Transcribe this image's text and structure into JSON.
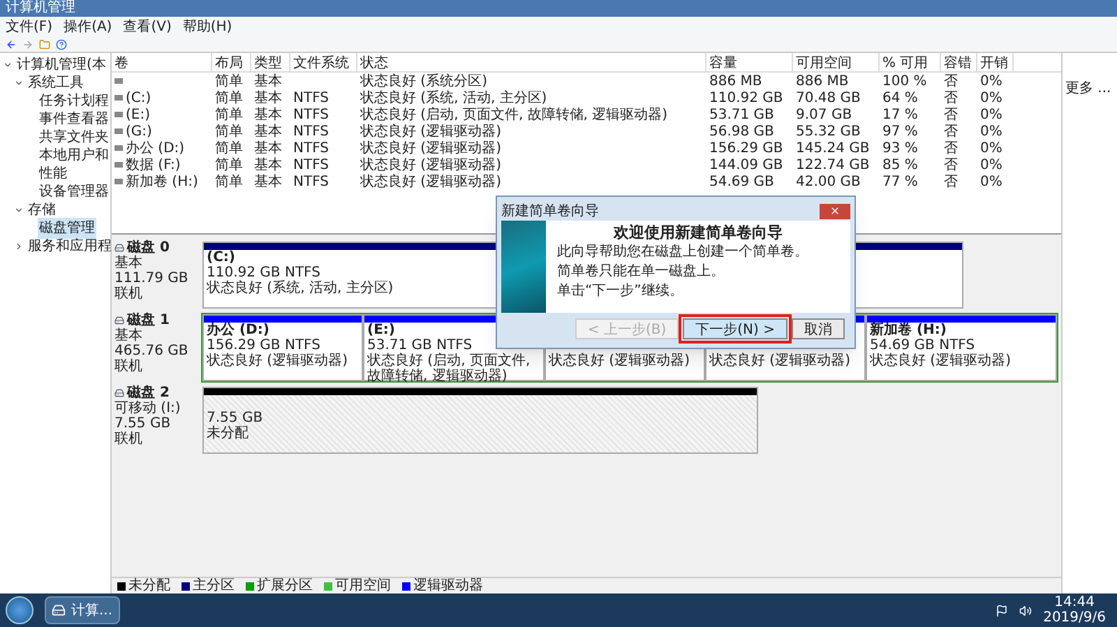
{
  "window": {
    "title": "计算机管理"
  },
  "menu": [
    "文件(F)",
    "操作(A)",
    "查看(V)",
    "帮助(H)"
  ],
  "tree": [
    {
      "label": "计算机管理(本",
      "expanded": true,
      "selected": false,
      "children": [
        {
          "label": "系统工具",
          "expanded": true,
          "selected": false,
          "children": [
            {
              "label": "任务计划程",
              "selected": false
            },
            {
              "label": "事件查看器",
              "selected": false
            },
            {
              "label": "共享文件夹",
              "selected": false
            },
            {
              "label": "本地用户和",
              "selected": false
            },
            {
              "label": "性能",
              "selected": false
            },
            {
              "label": "设备管理器",
              "selected": false
            }
          ]
        },
        {
          "label": "存储",
          "expanded": true,
          "selected": false,
          "children": [
            {
              "label": "磁盘管理",
              "selected": true
            }
          ]
        },
        {
          "label": "服务和应用程",
          "expanded": false,
          "selected": false
        }
      ]
    }
  ],
  "table": {
    "columns": [
      "卷",
      "布局",
      "类型",
      "文件系统",
      "状态",
      "容量",
      "可用空间",
      "% 可用",
      "容错",
      "开销"
    ],
    "rows": [
      {
        "layout": "简单",
        "type": "基本",
        "status": "状态良好 (系统分区)",
        "capacity": "886 MB",
        "free": "886 MB",
        "percent": "100 %",
        "fault": "否",
        "overhead": "0%"
      },
      {
        "volume": "(C:)",
        "layout": "简单",
        "type": "基本",
        "fs": "NTFS",
        "status": "状态良好 (系统, 活动, 主分区)",
        "capacity": "110.92 GB",
        "free": "70.48 GB",
        "percent": "64 %",
        "fault": "否",
        "overhead": "0%"
      },
      {
        "volume": "(E:)",
        "layout": "简单",
        "type": "基本",
        "fs": "NTFS",
        "status": "状态良好 (启动, 页面文件, 故障转储, 逻辑驱动器)",
        "capacity": "53.71 GB",
        "free": "9.07 GB",
        "percent": "17 %",
        "fault": "否",
        "overhead": "0%"
      },
      {
        "volume": "(G:)",
        "layout": "简单",
        "type": "基本",
        "fs": "NTFS",
        "status": "状态良好 (逻辑驱动器)",
        "capacity": "56.98 GB",
        "free": "55.32 GB",
        "percent": "97 %",
        "fault": "否",
        "overhead": "0%"
      },
      {
        "volume": "办公 (D:)",
        "layout": "简单",
        "type": "基本",
        "fs": "NTFS",
        "status": "状态良好 (逻辑驱动器)",
        "capacity": "156.29 GB",
        "free": "145.24 GB",
        "percent": "93 %",
        "fault": "否",
        "overhead": "0%"
      },
      {
        "volume": "数据 (F:)",
        "layout": "简单",
        "type": "基本",
        "fs": "NTFS",
        "status": "状态良好 (逻辑驱动器)",
        "capacity": "144.09 GB",
        "free": "122.74 GB",
        "percent": "85 %",
        "fault": "否",
        "overhead": "0%"
      },
      {
        "volume": "新加卷 (H:)",
        "layout": "简单",
        "type": "基本",
        "fs": "NTFS",
        "status": "状态良好 (逻辑驱动器)",
        "capacity": "54.69 GB",
        "free": "42.00 GB",
        "percent": "77 %",
        "fault": "否",
        "overhead": "0%"
      }
    ]
  },
  "disks": [
    {
      "name": "磁盘 0",
      "type": "基本",
      "size": "111.79 GB",
      "state": "联机",
      "partitions": [
        {
          "kind": "primary",
          "name": "(C:)",
          "size": "110.92 GB NTFS",
          "status": "状态良好 (系统, 活动, 主分区)"
        }
      ]
    },
    {
      "name": "磁盘 1",
      "type": "基本",
      "size": "465.76 GB",
      "state": "联机",
      "extended": true,
      "partitions": [
        {
          "kind": "logical",
          "name": "办公 (D:)",
          "size": "156.29 GB NTFS",
          "status": "状态良好 (逻辑驱动器)"
        },
        {
          "kind": "logical",
          "name": "(E:)",
          "size": "53.71 GB NTFS",
          "status": "状态良好 (启动, 页面文件, 故障转储, 逻辑驱动器)"
        },
        {
          "kind": "logical",
          "status": "状态良好 (逻辑驱动器)"
        },
        {
          "kind": "logical",
          "status": "状态良好 (逻辑驱动器)"
        },
        {
          "kind": "logical",
          "name": "新加卷 (H:)",
          "size": "54.69 GB NTFS",
          "status": "状态良好 (逻辑驱动器)"
        }
      ]
    },
    {
      "name": "磁盘 2",
      "type": "可移动 (I:)",
      "size": "7.55 GB",
      "state": "联机",
      "partitions": [
        {
          "kind": "unallocated",
          "size": "7.55 GB",
          "status": "未分配"
        }
      ]
    }
  ],
  "legend": [
    {
      "label": "未分配",
      "color": "#000000"
    },
    {
      "label": "主分区",
      "color": "#00007f"
    },
    {
      "label": "扩展分区",
      "color": "#00a000"
    },
    {
      "label": "可用空间",
      "color": "#40c040"
    },
    {
      "label": "逻辑驱动器",
      "color": "#0000ff"
    }
  ],
  "actions": {
    "items": [
      "更多 ..."
    ]
  },
  "dialog": {
    "title": "新建简单卷向导",
    "heading": "欢迎使用新建简单卷向导",
    "paragraphs": [
      "此向导帮助您在磁盘上创建一个简单卷。",
      "简单卷只能在单一磁盘上。",
      "单击“下一步”继续。"
    ],
    "buttons": [
      {
        "label": "< 上一步(B)",
        "disabled": true,
        "highlighted": false
      },
      {
        "label": "下一步(N) >",
        "disabled": false,
        "highlighted": true
      },
      {
        "label": "取消",
        "disabled": false,
        "highlighted": false
      }
    ]
  },
  "taskbar": {
    "task": "计算...",
    "time": "14:44",
    "date": "2019/9/6"
  }
}
